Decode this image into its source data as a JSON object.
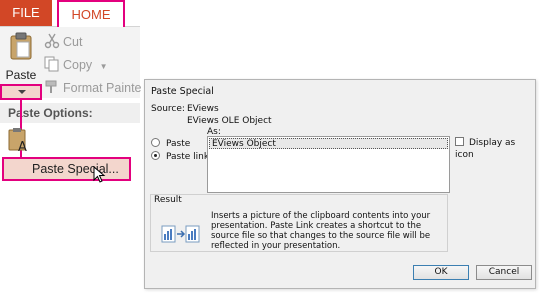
{
  "ribbon": {
    "tabs": {
      "file": "FILE",
      "home": "HOME"
    },
    "paste_label": "Paste",
    "cut_label": "Cut",
    "copy_label": "Copy",
    "format_painter_label": "Format Painte",
    "paste_options_header": "Paste Options:",
    "paste_special_label": "Paste Special..."
  },
  "dialog": {
    "title": "Paste Special",
    "source_label": "Source:",
    "source_line1": "EViews",
    "source_line2": "EViews OLE Object",
    "as_label": "As:",
    "options": {
      "paste": "Paste",
      "paste_link": "Paste link"
    },
    "selected_option": "paste_link",
    "list_items": [
      "EViews Object"
    ],
    "display_as_icon_label": "Display as icon",
    "display_as_icon_checked": false,
    "result_label": "Result",
    "result_text": "Inserts a picture of the clipboard contents into your presentation. Paste Link creates a shortcut to the source file so that changes to the source file will be reflected in your presentation.",
    "ok_label": "OK",
    "cancel_label": "Cancel"
  },
  "colors": {
    "accent_file": "#d24726",
    "highlight": "#e3007e",
    "highlight_fill": "#f3d6cd"
  }
}
